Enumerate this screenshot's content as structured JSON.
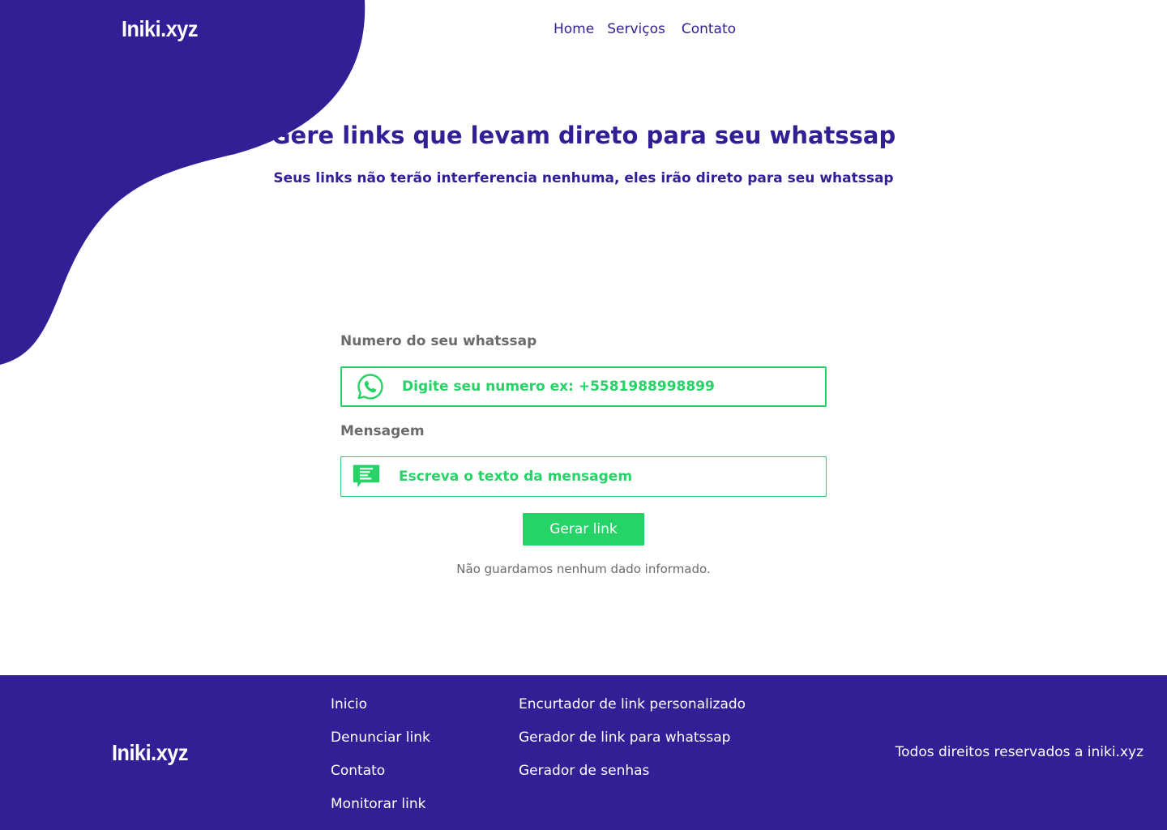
{
  "header": {
    "logo": "Iniki.xyz",
    "nav": [
      "Home",
      "Serviços",
      "Contato"
    ]
  },
  "hero": {
    "title": "Gere links que levam direto para seu whatssap",
    "subtitle": "Seus links não terão interferencia nenhuma, eles irão direto para seu whatssap"
  },
  "form": {
    "phone_label": "Numero do seu whatssap",
    "phone_placeholder": "Digite seu numero ex: +5581988998899",
    "message_label": "Mensagem",
    "message_placeholder": "Escreva o texto da mensagem",
    "submit_label": "Gerar link",
    "privacy_note": "Não guardamos nenhum dado informado."
  },
  "footer": {
    "logo": "Iniki.xyz",
    "col1": [
      "Inicio",
      "Denunciar link",
      "Contato",
      "Monitorar link"
    ],
    "col2": [
      "Encurtador de link personalizado",
      "Gerador de link para whatssap",
      "Gerador de senhas"
    ],
    "copyright": "Todos direitos reservados a iniki.xyz"
  },
  "colors": {
    "brand": "#331e96",
    "accent": "#25d366",
    "muted": "#6b6b6b"
  },
  "icons": {
    "phone_field": "whatsapp-icon",
    "message_field": "message-icon"
  }
}
